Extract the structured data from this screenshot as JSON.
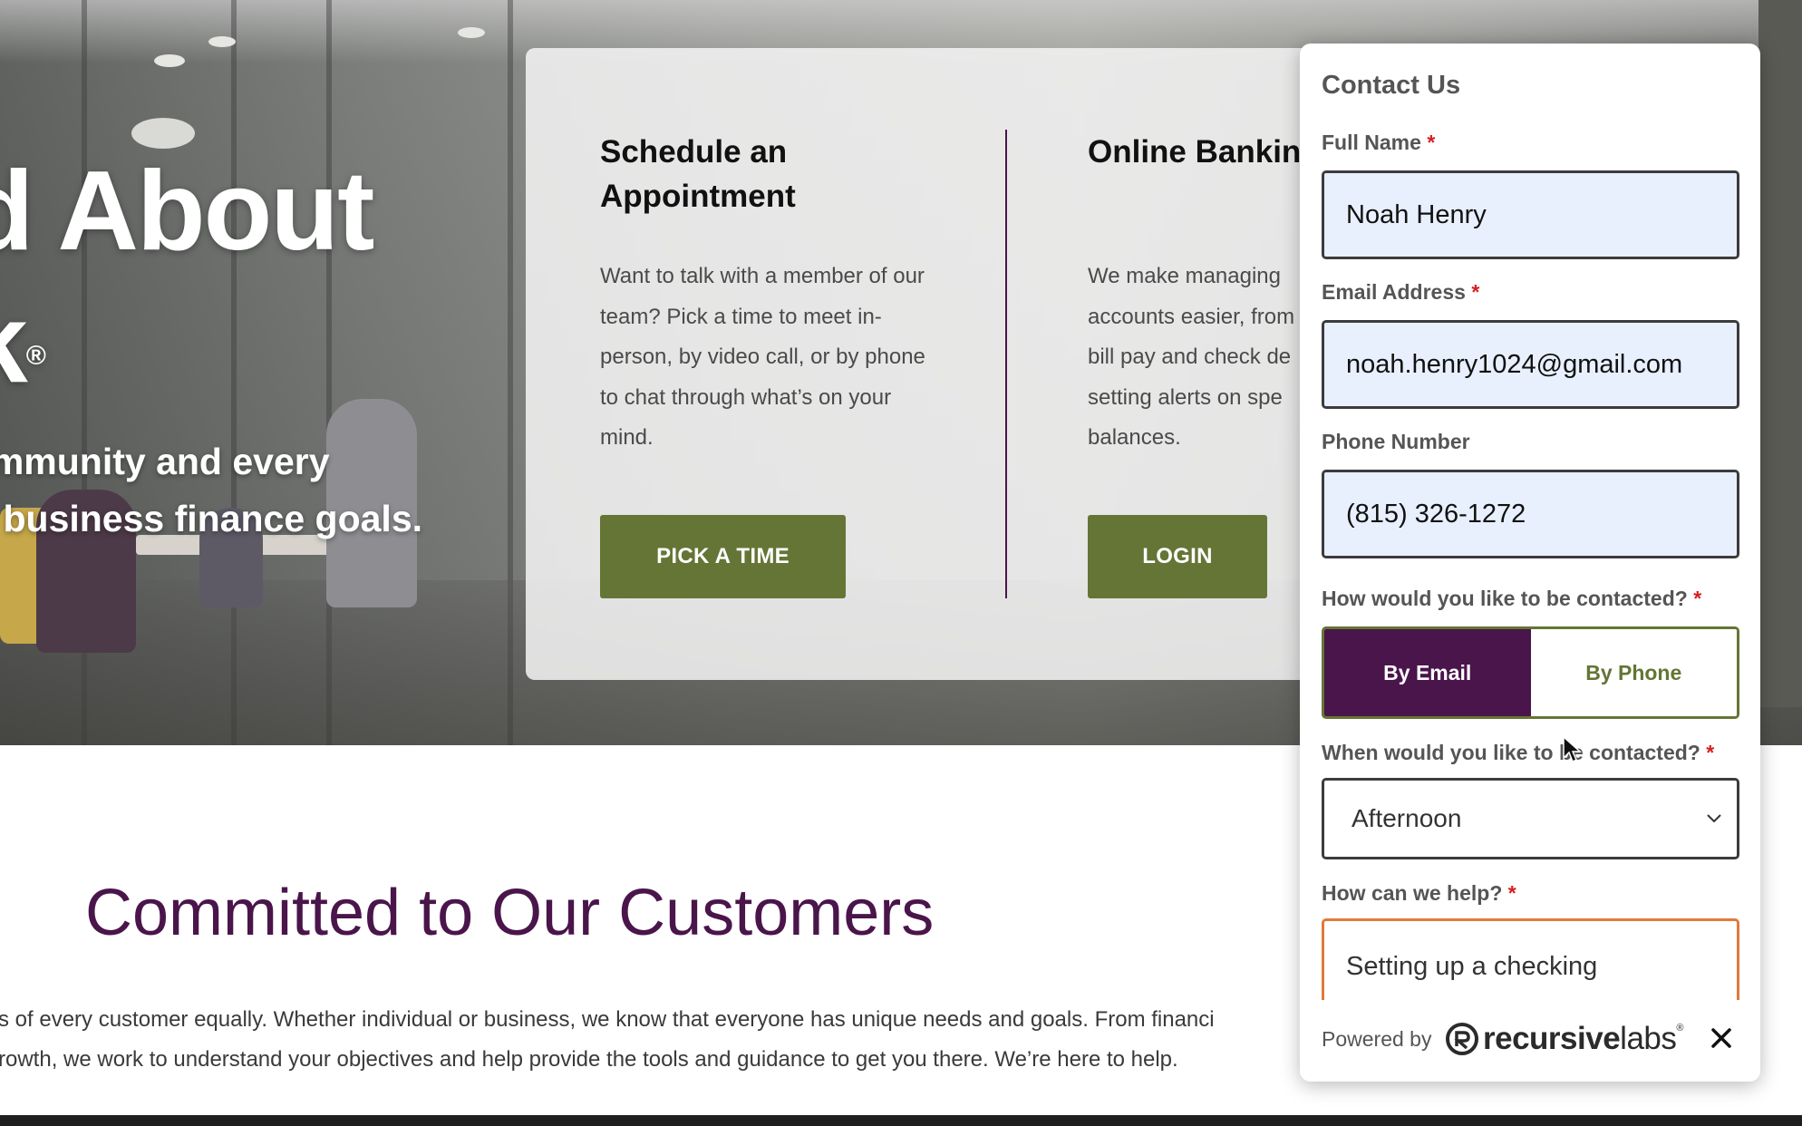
{
  "hero": {
    "title_line1": "od About",
    "title_line2": "nk",
    "title_reg": "®",
    "subtitle_line1": "community and every",
    "subtitle_line2": "nd business finance goals."
  },
  "cards": {
    "appointment": {
      "title": "Schedule an Appointment",
      "text": "Want to talk with a member of our team? Pick a time to meet in-person, by video call, or by phone to chat through what’s on your mind.",
      "button": "PICK A TIME"
    },
    "online_banking": {
      "title": "Online Banking",
      "text_lines": [
        "We make managing",
        "accounts easier, from",
        "bill pay and check de",
        "setting alerts on spe",
        "balances."
      ],
      "button": "LOGIN"
    }
  },
  "committed": {
    "title": "Committed to Our Customers",
    "line1": "s of every customer equally. Whether individual or business, we know that everyone has unique needs and goals. From financi",
    "line2": "rowth, we work to understand your objectives and help provide the tools and guidance to get you there. We’re here to help."
  },
  "contact_form": {
    "title": "Contact Us",
    "required_mark": "*",
    "full_name": {
      "label": "Full Name",
      "value": "Noah Henry"
    },
    "email": {
      "label": "Email Address",
      "value": "noah.henry1024@gmail.com"
    },
    "phone": {
      "label": "Phone Number",
      "value": "(815) 326-1272"
    },
    "contact_method": {
      "label": "How would you like to be contacted?",
      "options": [
        "By Email",
        "By Phone"
      ],
      "selected": "By Email"
    },
    "contact_time": {
      "label": "When would you like to be contacted?",
      "value": "Afternoon"
    },
    "help": {
      "label": "How can we help?",
      "value": "Setting up a checking"
    },
    "footer": {
      "powered_by": "Powered by",
      "brand_bold": "recursive",
      "brand_light": "labs",
      "brand_reg": "®"
    }
  },
  "colors": {
    "brand_purple": "#4a154b",
    "brand_green": "#657535",
    "required_red": "#d61f1f",
    "autofill_blue": "#e8f0fe",
    "focus_orange": "#e07a3a"
  },
  "icons": [
    "chevron-down-icon",
    "close-icon",
    "recursivelabs-logo-icon",
    "cursor-icon"
  ]
}
